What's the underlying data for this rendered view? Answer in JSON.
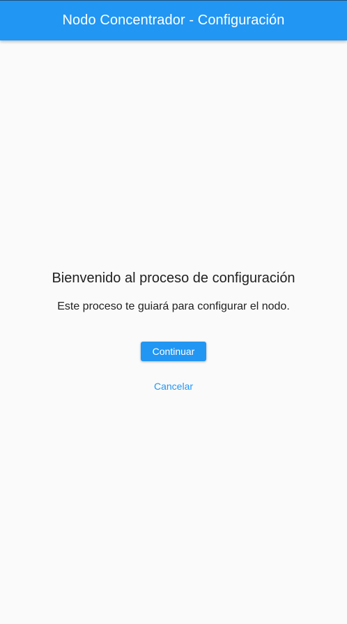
{
  "app_bar": {
    "title": "Nodo Concentrador - Configuración",
    "color": "#2196f3"
  },
  "main": {
    "heading": "Bienvenido al proceso de configuración",
    "description": "Este proceso te guiará para configurar el nodo.",
    "continue_label": "Continuar",
    "cancel_label": "Cancelar"
  },
  "colors": {
    "primary": "#2196f3",
    "background": "#fafafa",
    "text": "#212121"
  }
}
